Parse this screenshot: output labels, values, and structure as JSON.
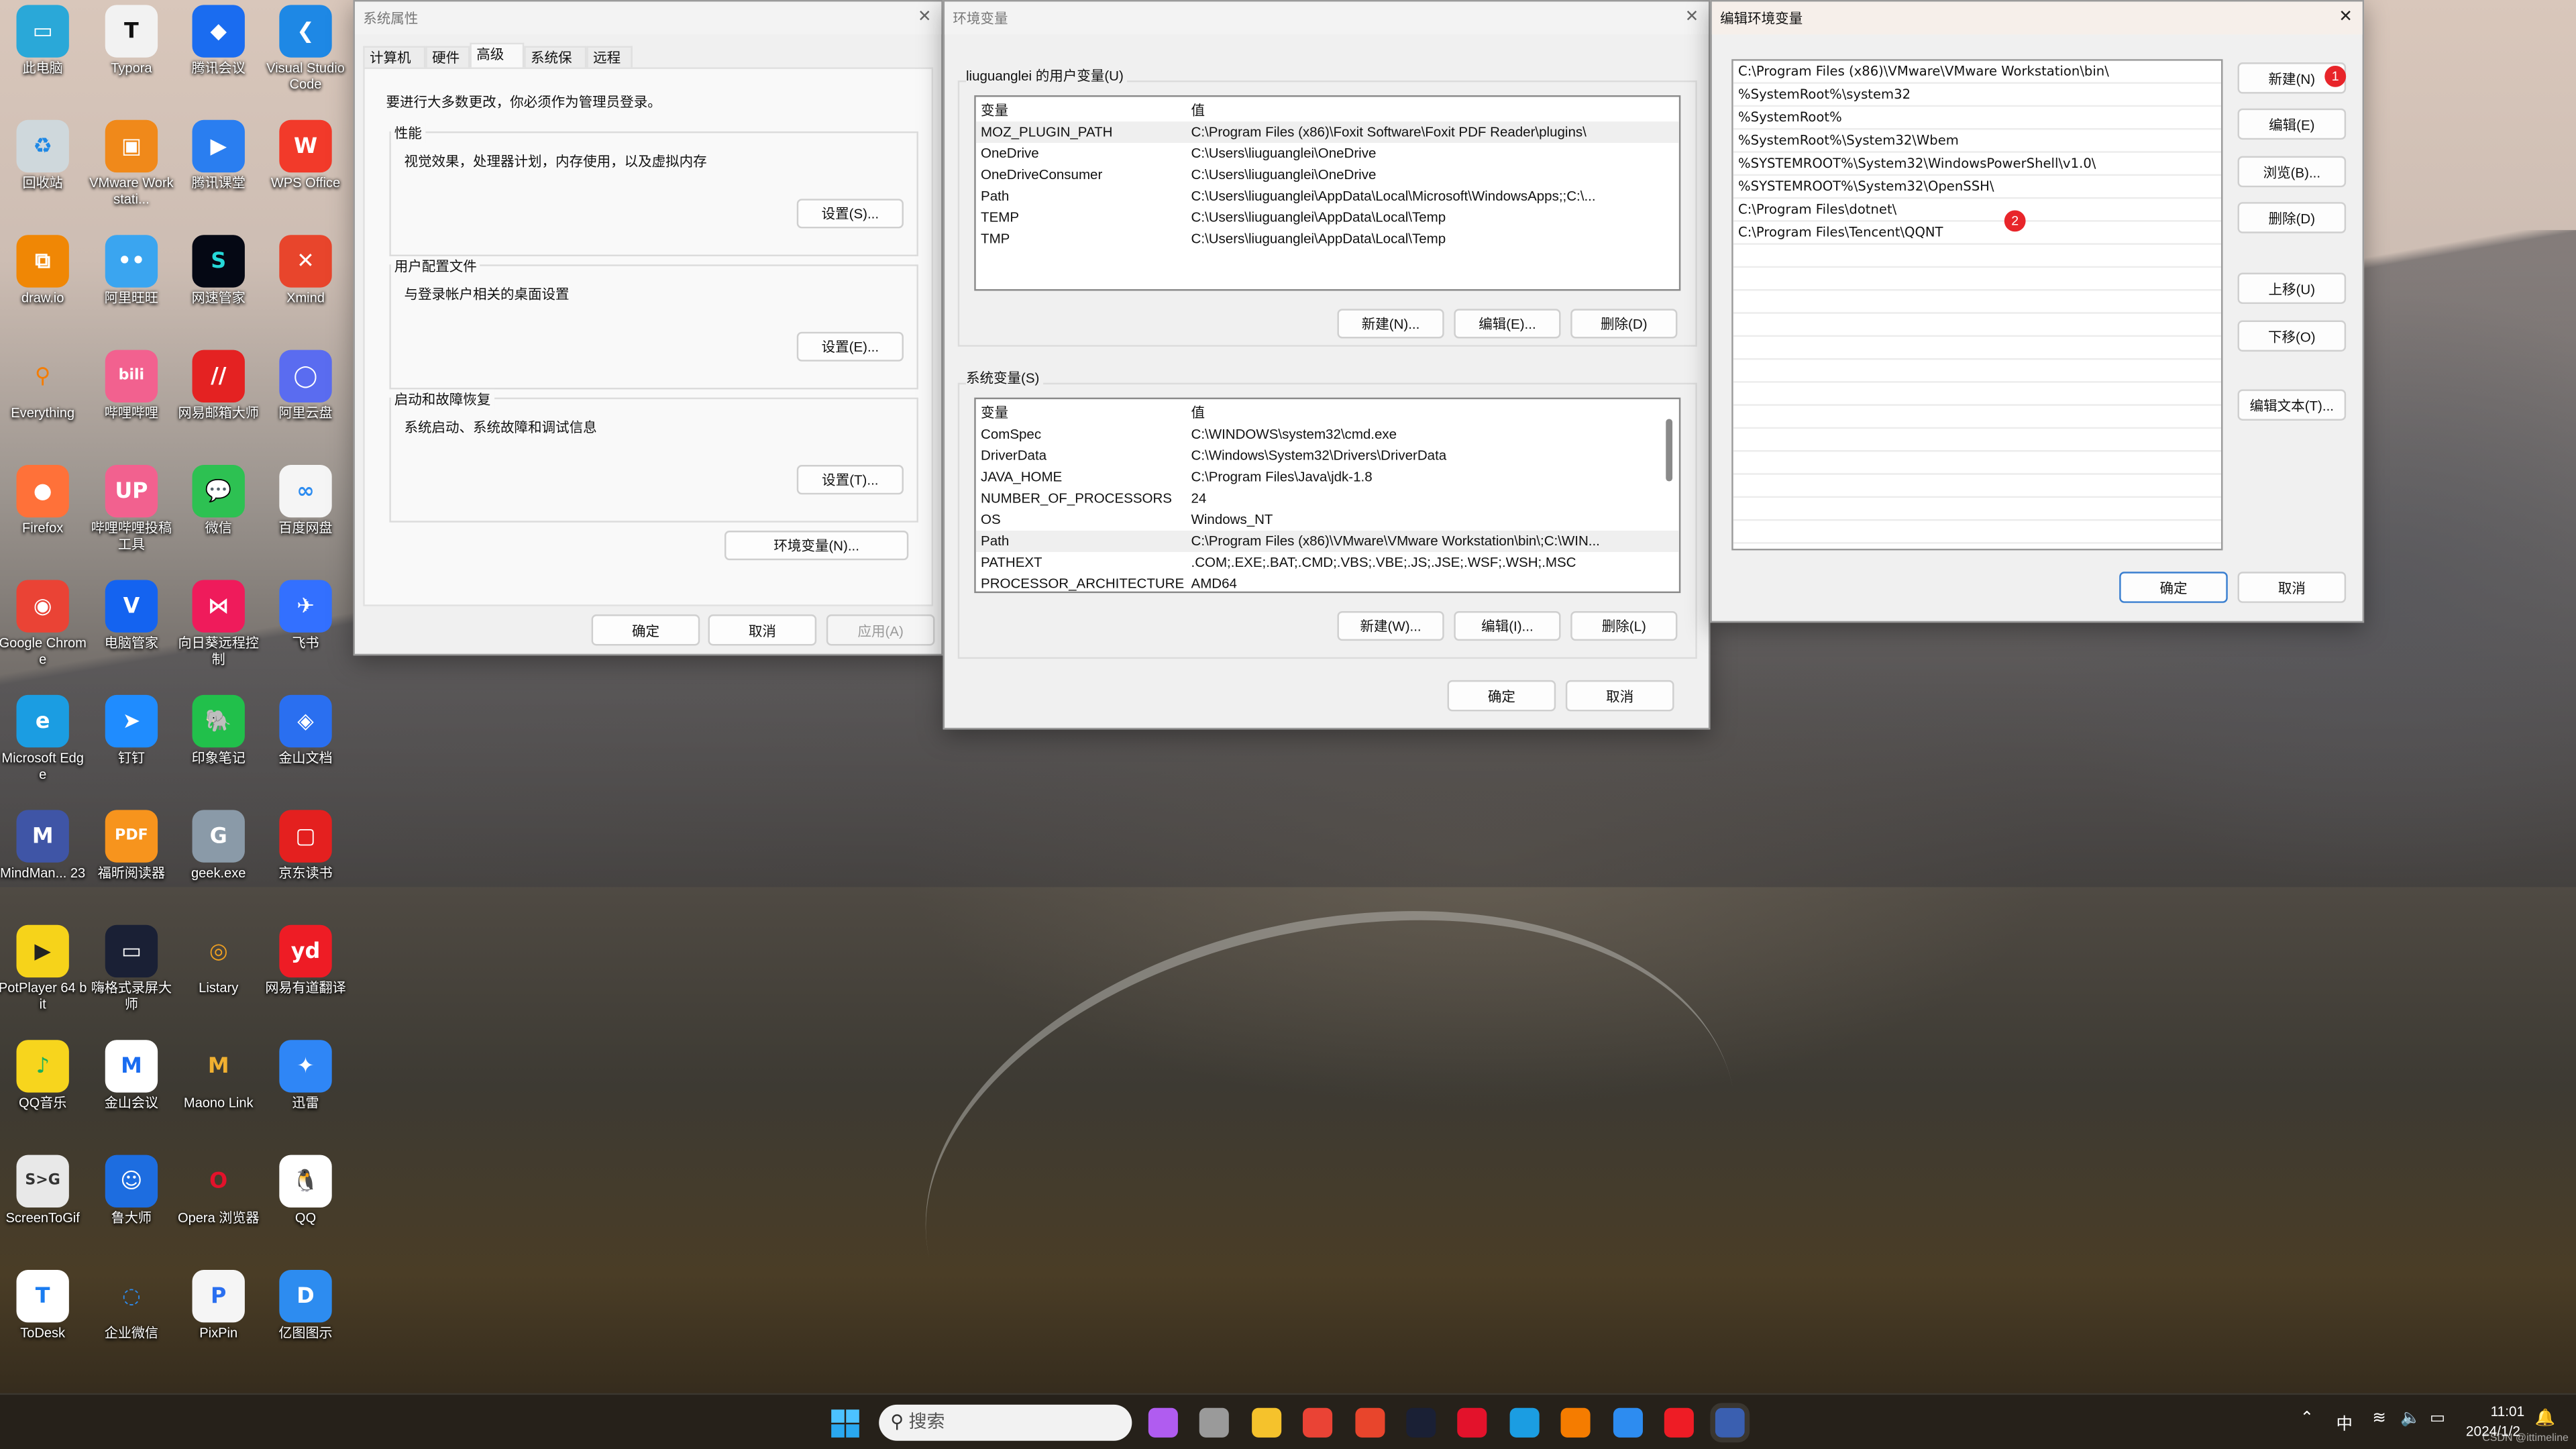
{
  "desktop": {
    "icons": [
      {
        "label": "此电脑",
        "color": "#2aa8d8",
        "glyph": "▭"
      },
      {
        "label": "Typora",
        "color": "#f2f2f2",
        "glyph": "T",
        "fg": "#111"
      },
      {
        "label": "腾讯会议",
        "color": "#1a6cf0",
        "glyph": "◆"
      },
      {
        "label": "Visual Studio Code",
        "color": "#1e88e5",
        "glyph": "❮"
      },
      {
        "label": "回收站",
        "color": "#cfd8dc",
        "glyph": "♻",
        "fg": "#1e88e5"
      },
      {
        "label": "VMware Workstati...",
        "color": "#f0891a",
        "glyph": "▣"
      },
      {
        "label": "腾讯课堂",
        "color": "#2a7ef0",
        "glyph": "▶"
      },
      {
        "label": "WPS Office",
        "color": "#f23a2a",
        "glyph": "W"
      },
      {
        "label": "draw.io",
        "color": "#f08705",
        "glyph": "⧉"
      },
      {
        "label": "阿里旺旺",
        "color": "#3aa5f0",
        "glyph": "••"
      },
      {
        "label": "网速管家",
        "color": "#050814",
        "glyph": "S",
        "fg": "#25d8d8"
      },
      {
        "label": "Xmind",
        "color": "#e8452c",
        "glyph": "✕"
      },
      {
        "label": "Everything",
        "color": "transparent",
        "glyph": "⚲",
        "fg": "#f57c00"
      },
      {
        "label": "哔哩哔哩",
        "color": "#f2618f",
        "glyph": "bili"
      },
      {
        "label": "网易邮箱大师",
        "color": "#e42222",
        "glyph": "//"
      },
      {
        "label": "阿里云盘",
        "color": "#5a6cf0",
        "glyph": "◯"
      },
      {
        "label": "Firefox",
        "color": "#ff7139",
        "glyph": "●"
      },
      {
        "label": "哔哩哔哩投稿工具",
        "color": "#f2618f",
        "glyph": "UP"
      },
      {
        "label": "微信",
        "color": "#2dc152",
        "glyph": "💬"
      },
      {
        "label": "百度网盘",
        "color": "#f5f5f5",
        "glyph": "∞",
        "fg": "#2d8cf0"
      },
      {
        "label": "Google Chrome",
        "color": "#ea4335",
        "glyph": "◉"
      },
      {
        "label": "电脑管家",
        "color": "#1463f0",
        "glyph": "V"
      },
      {
        "label": "向日葵远程控制",
        "color": "#ef1b5b",
        "glyph": "⋈"
      },
      {
        "label": "飞书",
        "color": "#3370ff",
        "glyph": "✈"
      },
      {
        "label": "Microsoft Edge",
        "color": "#1b9de2",
        "glyph": "e"
      },
      {
        "label": "钉钉",
        "color": "#1f8cff",
        "glyph": "➤"
      },
      {
        "label": "印象笔记",
        "color": "#21c04b",
        "glyph": "🐘"
      },
      {
        "label": "金山文档",
        "color": "#2a6ff0",
        "glyph": "◈"
      },
      {
        "label": "MindMan... 23",
        "color": "#3f55a6",
        "glyph": "M"
      },
      {
        "label": "福昕阅读器",
        "color": "#f7941d",
        "glyph": "PDF"
      },
      {
        "label": "geek.exe",
        "color": "#8a9aa8",
        "glyph": "G"
      },
      {
        "label": "京东读书",
        "color": "#e4201f",
        "glyph": "▢"
      },
      {
        "label": "PotPlayer 64 bit",
        "color": "#f6d31a",
        "glyph": "▶",
        "fg": "#222"
      },
      {
        "label": "嗨格式录屏大师",
        "color": "#1a2035",
        "glyph": "▭"
      },
      {
        "label": "Listary",
        "color": "transparent",
        "glyph": "◎",
        "fg": "#f0a020"
      },
      {
        "label": "网易有道翻译",
        "color": "#ee1c25",
        "glyph": "yd"
      },
      {
        "label": "QQ音乐",
        "color": "#f7d51d",
        "glyph": "♪",
        "fg": "#19b05a"
      },
      {
        "label": "金山会议",
        "color": "#ffffff",
        "glyph": "M",
        "fg": "#1a6cf0"
      },
      {
        "label": "Maono Link",
        "color": "transparent",
        "glyph": "M",
        "fg": "#f0b030"
      },
      {
        "label": "迅雷",
        "color": "#2f86f6",
        "glyph": "✦"
      },
      {
        "label": "ScreenToGif",
        "color": "#e8e8e8",
        "glyph": "S>G",
        "fg": "#333"
      },
      {
        "label": "鲁大师",
        "color": "#1d6de0",
        "glyph": "☺"
      },
      {
        "label": "Opera 浏览器",
        "color": "transparent",
        "glyph": "O",
        "fg": "#e3122b"
      },
      {
        "label": "QQ",
        "color": "#ffffff",
        "glyph": "🐧",
        "fg": "#000"
      },
      {
        "label": "ToDesk",
        "color": "#ffffff",
        "glyph": "T",
        "fg": "#1a7cf0"
      },
      {
        "label": "企业微信",
        "color": "transparent",
        "glyph": "◌",
        "fg": "#2d8cf0"
      },
      {
        "label": "PixPin",
        "color": "#f5f5f5",
        "glyph": "P",
        "fg": "#2a6ff0"
      },
      {
        "label": "亿图图示",
        "color": "#2d8cf0",
        "glyph": "D"
      }
    ]
  },
  "sysprops": {
    "title": "系统属性",
    "tabs": [
      "计算机名",
      "硬件",
      "高级",
      "系统保护",
      "远程"
    ],
    "active_tab": "高级",
    "admin_note": "要进行大多数更改，你必须作为管理员登录。",
    "groups": [
      {
        "title": "性能",
        "desc": "视觉效果，处理器计划，内存使用，以及虚拟内存",
        "button": "设置(S)..."
      },
      {
        "title": "用户配置文件",
        "desc": "与登录帐户相关的桌面设置",
        "button": "设置(E)..."
      },
      {
        "title": "启动和故障恢复",
        "desc": "系统启动、系统故障和调试信息",
        "button": "设置(T)..."
      }
    ],
    "env_button": "环境变量(N)...",
    "ok": "确定",
    "cancel": "取消",
    "apply": "应用(A)"
  },
  "envvars": {
    "title": "环境变量",
    "user_label": "liuguanglei 的用户变量(U)",
    "col_var": "变量",
    "col_val": "值",
    "user_vars": [
      {
        "name": "MOZ_PLUGIN_PATH",
        "value": "C:\\Program Files (x86)\\Foxit Software\\Foxit PDF Reader\\plugins\\",
        "selected": true
      },
      {
        "name": "OneDrive",
        "value": "C:\\Users\\liuguanglei\\OneDrive"
      },
      {
        "name": "OneDriveConsumer",
        "value": "C:\\Users\\liuguanglei\\OneDrive"
      },
      {
        "name": "Path",
        "value": "C:\\Users\\liuguanglei\\AppData\\Local\\Microsoft\\WindowsApps;;C:\\..."
      },
      {
        "name": "TEMP",
        "value": "C:\\Users\\liuguanglei\\AppData\\Local\\Temp"
      },
      {
        "name": "TMP",
        "value": "C:\\Users\\liuguanglei\\AppData\\Local\\Temp"
      }
    ],
    "user_buttons": [
      "新建(N)...",
      "编辑(E)...",
      "删除(D)"
    ],
    "sys_label": "系统变量(S)",
    "sys_vars": [
      {
        "name": "ComSpec",
        "value": "C:\\WINDOWS\\system32\\cmd.exe"
      },
      {
        "name": "DriverData",
        "value": "C:\\Windows\\System32\\Drivers\\DriverData"
      },
      {
        "name": "JAVA_HOME",
        "value": "C:\\Program Files\\Java\\jdk-1.8"
      },
      {
        "name": "NUMBER_OF_PROCESSORS",
        "value": "24"
      },
      {
        "name": "OS",
        "value": "Windows_NT"
      },
      {
        "name": "Path",
        "value": "C:\\Program Files (x86)\\VMware\\VMware Workstation\\bin\\;C:\\WIN...",
        "selected": true
      },
      {
        "name": "PATHEXT",
        "value": ".COM;.EXE;.BAT;.CMD;.VBS;.VBE;.JS;.JSE;.WSF;.WSH;.MSC"
      },
      {
        "name": "PROCESSOR_ARCHITECTURE",
        "value": "AMD64"
      }
    ],
    "sys_buttons": [
      "新建(W)...",
      "编辑(I)...",
      "删除(L)"
    ],
    "ok": "确定",
    "cancel": "取消"
  },
  "editenv": {
    "title": "编辑环境变量",
    "entries": [
      "C:\\Program Files (x86)\\VMware\\VMware Workstation\\bin\\",
      "%SystemRoot%\\system32",
      "%SystemRoot%",
      "%SystemRoot%\\System32\\Wbem",
      "%SYSTEMROOT%\\System32\\WindowsPowerShell\\v1.0\\",
      "%SYSTEMROOT%\\System32\\OpenSSH\\",
      "C:\\Program Files\\dotnet\\",
      "C:\\Program Files\\Tencent\\QQNT"
    ],
    "buttons": {
      "new": "新建(N)",
      "edit": "编辑(E)",
      "browse": "浏览(B)...",
      "delete": "删除(D)",
      "up": "上移(U)",
      "down": "下移(O)",
      "edit_text": "编辑文本(T)..."
    },
    "badges": [
      "1",
      "2"
    ],
    "ok": "确定",
    "cancel": "取消"
  },
  "taskbar": {
    "search_placeholder": "搜索",
    "apps": [
      {
        "name": "copilot",
        "color": "#b05cf0"
      },
      {
        "name": "task-view",
        "color": "#9a9a9a"
      },
      {
        "name": "file-explorer",
        "color": "#f5c22c"
      },
      {
        "name": "chrome",
        "color": "#ea4335"
      },
      {
        "name": "xmind",
        "color": "#e8452c"
      },
      {
        "name": "screen-recorder",
        "color": "#1a2035"
      },
      {
        "name": "opera",
        "color": "#e3122b"
      },
      {
        "name": "edge",
        "color": "#1b9de2"
      },
      {
        "name": "everything",
        "color": "#f57c00"
      },
      {
        "name": "edraw",
        "color": "#2d8cf0"
      },
      {
        "name": "youdao",
        "color": "#ee1c25"
      },
      {
        "name": "system-properties",
        "color": "#3a5fb0"
      }
    ],
    "ime": "中",
    "time": "11:01",
    "date": "2024/1/2",
    "watermark": "CSDN @ittimeline"
  }
}
